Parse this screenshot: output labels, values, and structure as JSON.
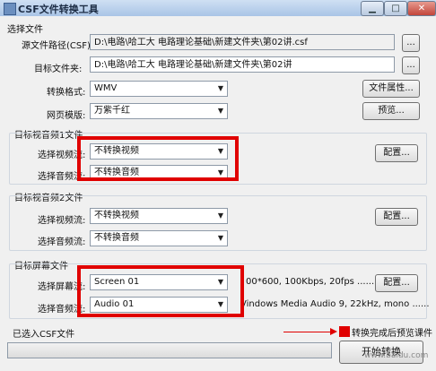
{
  "window": {
    "title": "CSF文件转换工具",
    "min_label": "▁",
    "max_label": "□",
    "close_label": "✕"
  },
  "select_file": {
    "section_title": "选择文件",
    "source_label": "源文件路径(CSF):",
    "source_value": "D:\\电路\\哈工大 电路理论基础\\新建文件夹\\第02讲.csf",
    "target_label": "目标文件夹:",
    "target_value": "D:\\电路\\哈工大 电路理论基础\\新建文件夹\\第02讲",
    "browse_label": "...",
    "format_label": "转换格式:",
    "format_value": "WMV",
    "file_props_button": "文件属性...",
    "template_label": "网页模版:",
    "template_value": "万紫千红",
    "preview_button": "预览..."
  },
  "av1": {
    "section_title": "目标视音频1文件",
    "video_label": "选择视频流:",
    "video_value": "不转换视频",
    "audio_label": "选择音频流:",
    "audio_value": "不转换音频",
    "config_button": "配置..."
  },
  "av2": {
    "section_title": "目标视音频2文件",
    "video_label": "选择视频流:",
    "video_value": "不转换视频",
    "audio_label": "选择音频流:",
    "audio_value": "不转换音频",
    "config_button": "配置..."
  },
  "screen": {
    "section_title": "目标屏幕文件",
    "screen_label": "选择屏幕流:",
    "screen_value": "Screen 01",
    "screen_info": "00*600, 100Kbps, 20fps ......",
    "audio_label": "选择音频流:",
    "audio_value": "Audio 01",
    "audio_info": "Vindows Media Audio 9, 22kHz, mono ......",
    "config_button": "配置..."
  },
  "status": {
    "loaded_label": "已选入CSF文件",
    "preview_after_label": "转换完成后预览课件",
    "start_button": "开始转换",
    "watermark": "www.baidu.com"
  }
}
